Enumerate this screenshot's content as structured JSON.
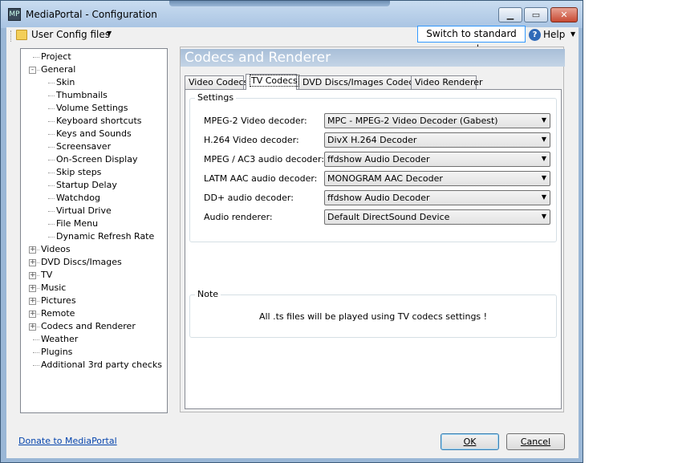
{
  "window": {
    "title": "MediaPortal - Configuration",
    "min_glyph": "▁",
    "max_glyph": "▭",
    "close_glyph": "✕"
  },
  "toolbar": {
    "user_config_label": "User Config files",
    "switch_label": "Switch to standard mode",
    "help_label": "Help"
  },
  "tree": {
    "items": [
      {
        "label": "Project",
        "level": 1,
        "expander": ""
      },
      {
        "label": "General",
        "level": 1,
        "expander": "-"
      },
      {
        "label": "Skin",
        "level": 2,
        "expander": ""
      },
      {
        "label": "Thumbnails",
        "level": 2,
        "expander": ""
      },
      {
        "label": "Volume Settings",
        "level": 2,
        "expander": ""
      },
      {
        "label": "Keyboard shortcuts",
        "level": 2,
        "expander": ""
      },
      {
        "label": "Keys and Sounds",
        "level": 2,
        "expander": ""
      },
      {
        "label": "Screensaver",
        "level": 2,
        "expander": ""
      },
      {
        "label": "On-Screen Display",
        "level": 2,
        "expander": ""
      },
      {
        "label": "Skip steps",
        "level": 2,
        "expander": ""
      },
      {
        "label": "Startup Delay",
        "level": 2,
        "expander": ""
      },
      {
        "label": "Watchdog",
        "level": 2,
        "expander": ""
      },
      {
        "label": "Virtual Drive",
        "level": 2,
        "expander": ""
      },
      {
        "label": "File Menu",
        "level": 2,
        "expander": ""
      },
      {
        "label": "Dynamic Refresh Rate",
        "level": 2,
        "expander": ""
      },
      {
        "label": "Videos",
        "level": 1,
        "expander": "+"
      },
      {
        "label": "DVD Discs/Images",
        "level": 1,
        "expander": "+"
      },
      {
        "label": "TV",
        "level": 1,
        "expander": "+"
      },
      {
        "label": "Music",
        "level": 1,
        "expander": "+"
      },
      {
        "label": "Pictures",
        "level": 1,
        "expander": "+"
      },
      {
        "label": "Remote",
        "level": 1,
        "expander": "+"
      },
      {
        "label": "Codecs and Renderer",
        "level": 1,
        "expander": "+"
      },
      {
        "label": "Weather",
        "level": 1,
        "expander": ""
      },
      {
        "label": "Plugins",
        "level": 1,
        "expander": ""
      },
      {
        "label": "Additional 3rd party checks",
        "level": 1,
        "expander": ""
      }
    ]
  },
  "content": {
    "title": "Codecs and Renderer",
    "tabs": [
      {
        "label": "Video Codecs"
      },
      {
        "label": "TV Codecs",
        "active": true
      },
      {
        "label": "DVD Discs/Images Codecs"
      },
      {
        "label": "Video Renderer"
      }
    ],
    "settings_group": "Settings",
    "rows": [
      {
        "label": "MPEG-2 Video decoder:",
        "value": "MPC - MPEG-2 Video Decoder (Gabest)"
      },
      {
        "label": "H.264 Video decoder:",
        "value": "DivX H.264 Decoder"
      },
      {
        "label": "MPEG / AC3 audio decoder:",
        "value": "ffdshow Audio Decoder"
      },
      {
        "label": "LATM AAC audio decoder:",
        "value": "MONOGRAM AAC Decoder"
      },
      {
        "label": "DD+ audio decoder:",
        "value": "ffdshow Audio Decoder"
      },
      {
        "label": "Audio renderer:",
        "value": "Default DirectSound Device"
      }
    ],
    "note_group": "Note",
    "note_text": "All .ts files will be played using TV codecs settings !"
  },
  "footer": {
    "donate_link": "Donate to MediaPortal",
    "ok_label": "OK",
    "cancel_label": "Cancel"
  },
  "icons": {
    "app": "mediaportal-icon",
    "folder": "folder-icon",
    "help": "help-icon",
    "dropdown": "▼"
  }
}
